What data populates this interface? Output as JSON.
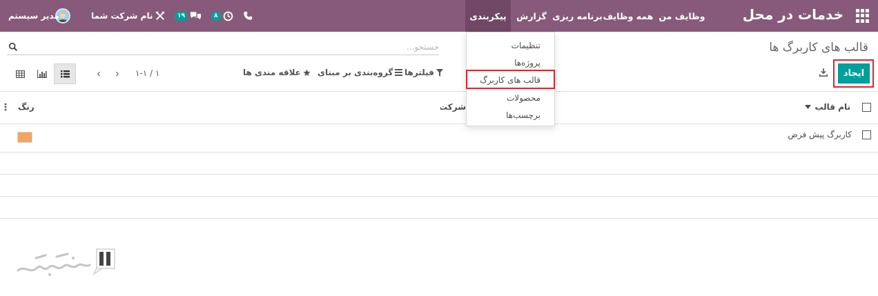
{
  "navbar": {
    "brand": "خدمات در محل",
    "menus": [
      "وظایف من",
      "همه وظایف",
      "برنامه ریزی",
      "گزارش",
      "پیکربندی"
    ],
    "active_menu": "پیکربندی",
    "activity_count": "۸",
    "messages_count": "۱۹",
    "company": "نام شرکت شما",
    "user": "مدیر سیستم"
  },
  "control_panel": {
    "title": "قالب های کاربرگ ها",
    "search_placeholder": "جستجو...",
    "create_label": "ایجاد",
    "filters_label": "فیلترها",
    "groupby_label": "گروه‌بندی بر مبنای",
    "favorites_label": "علاقه مندی ها",
    "pager": "۱-۱ / ۱"
  },
  "list": {
    "columns": [
      "نام قالب",
      "شرکت ها",
      "رنگ"
    ],
    "rows": [
      {
        "name": "کاربرگ پیش فرض",
        "company": "",
        "color": "#f4a460"
      }
    ]
  },
  "dropdown": {
    "items": [
      "تنظیمات",
      "پروژه‌ها",
      "قالب های کاربرگ",
      "محصولات",
      "برچسب‌ها"
    ],
    "highlighted": "قالب های کاربرگ"
  },
  "colors": {
    "navbar": "#875a7b",
    "primary": "#00a09d",
    "highlight_frame": "#e3222b"
  }
}
